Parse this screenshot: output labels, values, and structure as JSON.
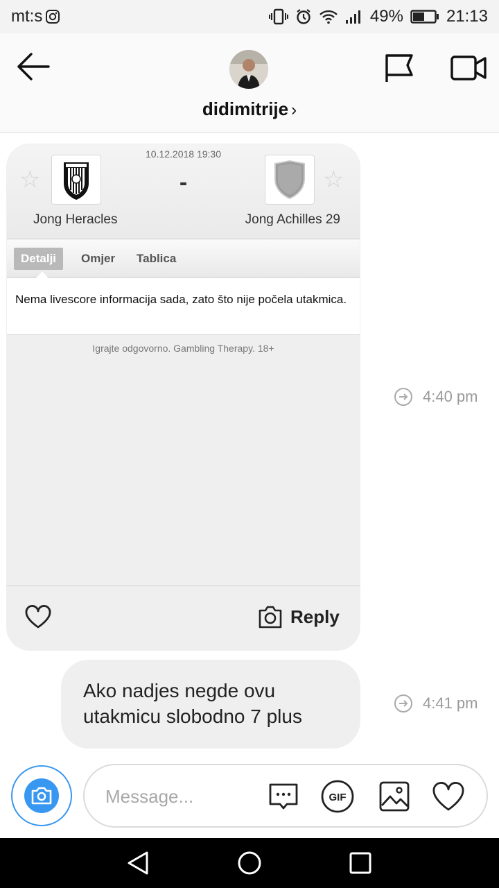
{
  "status_bar": {
    "carrier": "mt:s",
    "battery": "49%",
    "time": "21:13"
  },
  "header": {
    "username": "didimitrije",
    "chevron": "›"
  },
  "shared_post": {
    "match_datetime": "10.12.2018 19:30",
    "score": "-",
    "home_team": "Jong Heracles",
    "away_team": "Jong Achilles 29",
    "tabs": [
      {
        "label": "Detalji",
        "active": true
      },
      {
        "label": "Omjer",
        "active": false
      },
      {
        "label": "Tablica",
        "active": false
      }
    ],
    "info_text": "Nema livescore informacija sada, zato što nije počela utakmica.",
    "disclaimer": "Igrajte odgovorno. Gambling Therapy. 18+",
    "reply_label": "Reply",
    "timestamp": "4:40 pm"
  },
  "text_message": {
    "text": "Ako nadjes negde ovu utakmicu slobodno 7 plus",
    "timestamp": "4:41 pm"
  },
  "composer": {
    "placeholder": "Message...",
    "gif_label": "GIF"
  },
  "colors": {
    "accent": "#3897f0",
    "bubble": "#efefef"
  },
  "icons": [
    "arrow-left-icon",
    "flag-icon",
    "video-camera-icon",
    "heart-icon",
    "camera-icon",
    "send-arrow-icon",
    "chat-dots-icon",
    "gif-icon",
    "image-icon",
    "nav-back-icon",
    "nav-home-icon",
    "nav-recents-icon"
  ]
}
